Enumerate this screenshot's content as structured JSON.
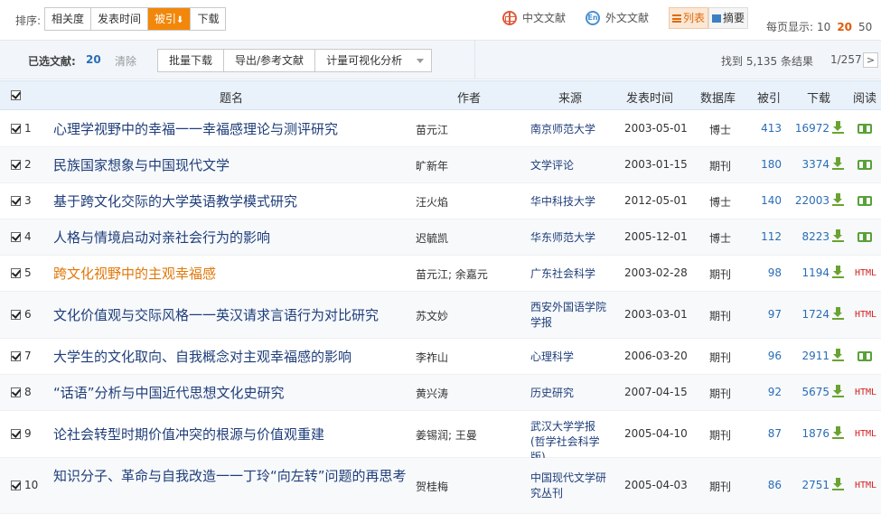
{
  "sort": {
    "label": "排序:",
    "options": [
      "相关度",
      "发表时间",
      "被引",
      "下载"
    ],
    "active_index": 2,
    "active_arrow": "⬇"
  },
  "language": {
    "chinese": "中文文献",
    "foreign": "外文文献",
    "chinese_icon": "chinese-literature-icon",
    "foreign_icon": "en-globe-icon"
  },
  "view": {
    "list_label": "列表",
    "abstract_label": "摘要"
  },
  "per_page": {
    "label": "每页显示:",
    "options": [
      "10",
      "20",
      "50"
    ],
    "active": "20"
  },
  "toolbar": {
    "selected_label": "已选文献:",
    "selected_count": "20",
    "clear_label": "清除",
    "batch_download": "批量下载",
    "export": "导出/参考文献",
    "visual_analysis": "计量可视化分析",
    "result_text": "找到 5,135 条结果",
    "page_text": "1/257",
    "next": ">"
  },
  "table": {
    "headers": {
      "title": "题名",
      "author": "作者",
      "source": "来源",
      "date": "发表时间",
      "database": "数据库",
      "cited": "被引",
      "downloads": "下载",
      "read": "阅读"
    },
    "rows": [
      {
        "num": "1",
        "title": "心理学视野中的幸福一一幸福感理论与测评研究",
        "author": "苗元江",
        "source": "南京师范大学",
        "date": "2003-05-01",
        "db": "博士",
        "cited": "413",
        "downloads": "16972",
        "read": "book"
      },
      {
        "num": "2",
        "title": "民族国家想象与中国现代文学",
        "author": "旷新年",
        "source": "文学评论",
        "date": "2003-01-15",
        "db": "期刊",
        "cited": "180",
        "downloads": "3374",
        "read": "book"
      },
      {
        "num": "3",
        "title": "基于跨文化交际的大学英语教学模式研究",
        "author": "汪火焰",
        "source": "华中科技大学",
        "date": "2012-05-01",
        "db": "博士",
        "cited": "140",
        "downloads": "22003",
        "read": "book"
      },
      {
        "num": "4",
        "title": "人格与情境启动对亲社会行为的影响",
        "author": "迟毓凯",
        "source": "华东师范大学",
        "date": "2005-12-01",
        "db": "博士",
        "cited": "112",
        "downloads": "8223",
        "read": "book"
      },
      {
        "num": "5",
        "title": "跨文化视野中的主观幸福感",
        "author": "苗元江; 余嘉元",
        "source": "广东社会科学",
        "date": "2003-02-28",
        "db": "期刊",
        "cited": "98",
        "downloads": "1194",
        "read": "HTML"
      },
      {
        "num": "6",
        "title": "文化价值观与交际风格一一英汉请求言语行为对比研究",
        "author": "苏文妙",
        "source": "西安外国语学院学报",
        "date": "2003-03-01",
        "db": "期刊",
        "cited": "97",
        "downloads": "1724",
        "read": "HTML"
      },
      {
        "num": "7",
        "title": "大学生的文化取向、自我概念对主观幸福感的影响",
        "author": "李祚山",
        "source": "心理科学",
        "date": "2006-03-20",
        "db": "期刊",
        "cited": "96",
        "downloads": "2911",
        "read": "book"
      },
      {
        "num": "8",
        "title": "“话语”分析与中国近代思想文化史研究",
        "author": "黄兴涛",
        "source": "历史研究",
        "date": "2007-04-15",
        "db": "期刊",
        "cited": "92",
        "downloads": "5675",
        "read": "HTML"
      },
      {
        "num": "9",
        "title": "论社会转型时期价值冲突的根源与价值观重建",
        "author": "姜锡润; 王曼",
        "source": "武汉大学学报(哲学社会科学版)",
        "date": "2005-04-10",
        "db": "期刊",
        "cited": "87",
        "downloads": "1876",
        "read": "HTML"
      },
      {
        "num": "10",
        "title": "知识分子、革命与自我改造一一丁玲“向左转”问题的再思考",
        "author": "贺桂梅",
        "source": "中国现代文学研究丛刊",
        "date": "2005-04-03",
        "db": "期刊",
        "cited": "86",
        "downloads": "2751",
        "read": "HTML"
      }
    ]
  },
  "colors": {
    "accent_orange": "#f2870a",
    "link_blue": "#1f3e7a",
    "count_blue": "#2a6db5",
    "download_green": "#6aa331",
    "html_red": "#d42020"
  }
}
